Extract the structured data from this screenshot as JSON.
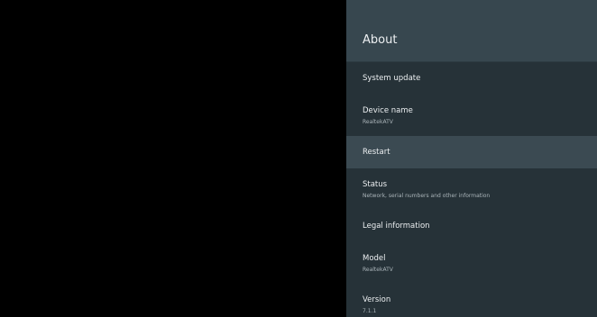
{
  "panel": {
    "title": "About",
    "items": [
      {
        "title": "System update",
        "subtitle": ""
      },
      {
        "title": "Device name",
        "subtitle": "RealtekATV"
      },
      {
        "title": "Restart",
        "subtitle": ""
      },
      {
        "title": "Status",
        "subtitle": "Network, serial numbers and other information"
      },
      {
        "title": "Legal information",
        "subtitle": ""
      },
      {
        "title": "Model",
        "subtitle": "RealtekATV"
      },
      {
        "title": "Version",
        "subtitle": "7.1.1"
      }
    ]
  },
  "colors": {
    "panel_background": "#263238",
    "header_background": "#37474f",
    "focused_item_background": "#3b4a52"
  }
}
